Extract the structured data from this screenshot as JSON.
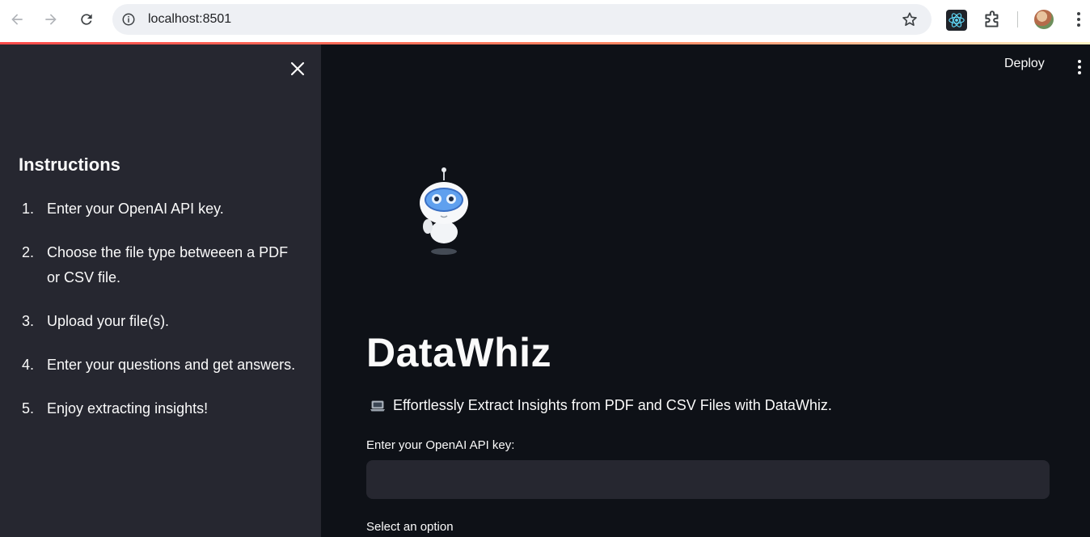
{
  "browser": {
    "url": "localhost:8501"
  },
  "sidebar": {
    "title": "Instructions",
    "items": [
      {
        "num": "1.",
        "text": "Enter your OpenAI API key."
      },
      {
        "num": "2.",
        "text": "Choose the file type betweeen a PDF or CSV file."
      },
      {
        "num": "3.",
        "text": "Upload your file(s)."
      },
      {
        "num": "4.",
        "text": "Enter your questions and get answers."
      },
      {
        "num": "5.",
        "text": "Enjoy extracting insights!"
      }
    ]
  },
  "header": {
    "deploy_label": "Deploy"
  },
  "main": {
    "title": "DataWhiz",
    "subtitle": "Effortlessly Extract Insights from PDF and CSV Files with DataWhiz.",
    "api_label": "Enter your OpenAI API key:",
    "api_value": "",
    "select_label": "Select an option"
  },
  "icons": {
    "back": "back-arrow-icon",
    "forward": "forward-arrow-icon",
    "reload": "reload-icon",
    "site_info": "site-info-icon",
    "bookmark": "star-icon",
    "react_ext": "react-icon",
    "extensions": "puzzle-icon",
    "menu": "kebab-menu-icon",
    "close": "close-icon",
    "laptop": "laptop-icon"
  },
  "colors": {
    "main_bg": "#0e1117",
    "sidebar_bg": "#262730",
    "accent": "#ff4b4b",
    "text": "#fafafa"
  }
}
